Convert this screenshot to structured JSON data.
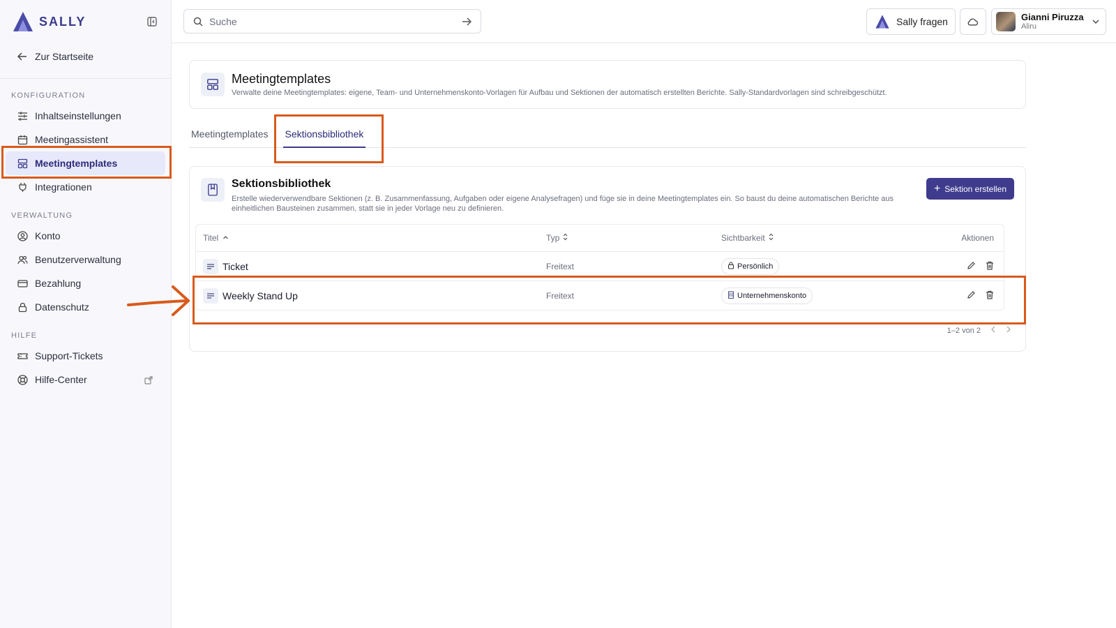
{
  "brand": {
    "name": "SALLY",
    "accent": "#3f3b8d",
    "annotation_color": "#d85a1c"
  },
  "sidebar": {
    "back_label": "Zur Startseite",
    "sections": {
      "config": {
        "label": "KONFIGURATION",
        "items": [
          "Inhaltseinstellungen",
          "Meetingassistent",
          "Meetingtemplates",
          "Integrationen"
        ]
      },
      "admin": {
        "label": "VERWALTUNG",
        "items": [
          "Konto",
          "Benutzerverwaltung",
          "Bezahlung",
          "Datenschutz"
        ]
      },
      "help": {
        "label": "HILFE",
        "items": [
          "Support-Tickets",
          "Hilfe-Center"
        ]
      }
    },
    "active_item": "Meetingtemplates"
  },
  "topbar": {
    "search_placeholder": "Suche",
    "ask_label": "Sally fragen",
    "user": {
      "name": "Gianni Piruzza",
      "org": "Aliru"
    }
  },
  "header": {
    "title": "Meetingtemplates",
    "description": "Verwalte deine Meetingtemplates: eigene, Team- und Unternehmenskonto-Vorlagen für Aufbau und Sektionen der automatisch erstellten Berichte. Sally-Standardvorlagen sind schreibgeschützt."
  },
  "tabs": [
    {
      "label": "Meetingtemplates",
      "active": false
    },
    {
      "label": "Sektionsbibliothek",
      "active": true
    }
  ],
  "library": {
    "title": "Sektionsbibliothek",
    "description": "Erstelle wiederverwendbare Sektionen (z. B. Zusammenfassung, Aufgaben oder eigene Analysefragen) und füge sie in deine Meetingtemplates ein. So baust du deine automatischen Berichte aus einheitlichen Bausteinen zusammen, statt sie in jeder Vorlage neu zu definieren.",
    "create_label": "Sektion erstellen",
    "columns": {
      "title": "Titel",
      "type": "Typ",
      "visibility": "Sichtbarkeit",
      "actions": "Aktionen"
    },
    "rows": [
      {
        "title": "Ticket",
        "type": "Freitext",
        "visibility": "Persönlich"
      },
      {
        "title": "Weekly Stand Up",
        "type": "Freitext",
        "visibility": "Unternehmenskonto"
      }
    ],
    "pagination": "1–2 von 2"
  }
}
